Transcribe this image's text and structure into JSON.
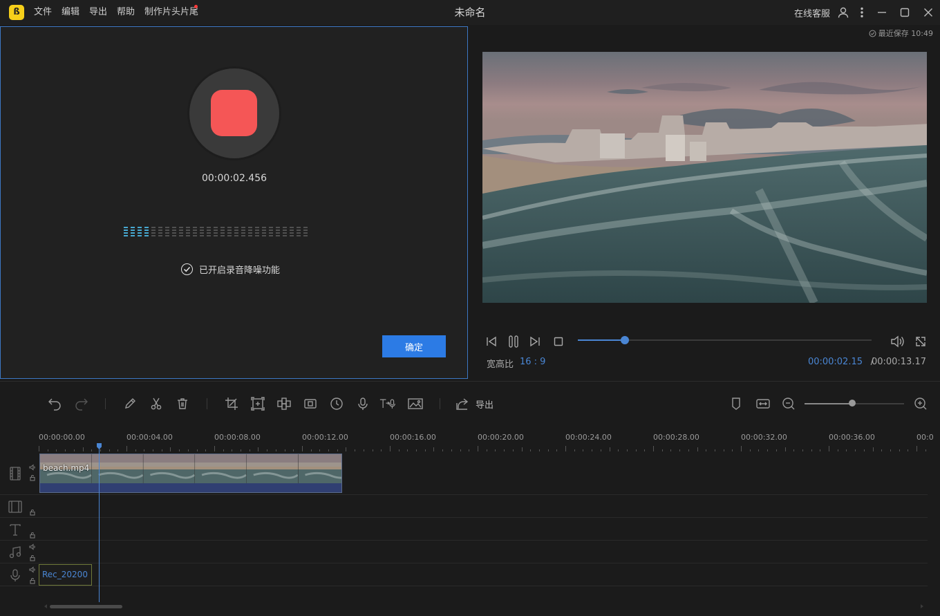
{
  "app": {
    "title": "未命名",
    "logo_glyph": "ß",
    "menu": [
      "文件",
      "编辑",
      "导出",
      "帮助",
      "制作片头片尾"
    ],
    "online_service": "在线客服"
  },
  "recorder": {
    "time": "00:00:02.456",
    "noise_reduction_label": "已开启录音降噪功能",
    "noise_reduction_on": true,
    "confirm_label": "确定",
    "level_active_bars": 4,
    "level_total_bars": 27,
    "stop_color": "#f55656"
  },
  "preview": {
    "autosave": "最近保存 10:49",
    "aspect_label": "宽高比",
    "aspect_value": "16 : 9",
    "current_time": "00:00:02.15",
    "time_sep": "/",
    "total_time": "00:00:13.17",
    "progress": 0.16
  },
  "toolbar": {
    "export_label": "导出",
    "zoom_level": 0.48
  },
  "timeline": {
    "ruler_labels": [
      "00:00:00.00",
      "00:00:04.00",
      "00:00:08.00",
      "00:00:12.00",
      "00:00:16.00",
      "00:00:20.00",
      "00:00:24.00",
      "00:00:28.00",
      "00:00:32.00",
      "00:00:36.00",
      "00:0"
    ],
    "video_clip": "beach.mp4",
    "audio_clip": "Rec_20200"
  },
  "colors": {
    "accent": "#2c7be5",
    "playhead": "#4a86d4",
    "level_active": "#4bb8e6",
    "level_inactive": "#555555"
  }
}
